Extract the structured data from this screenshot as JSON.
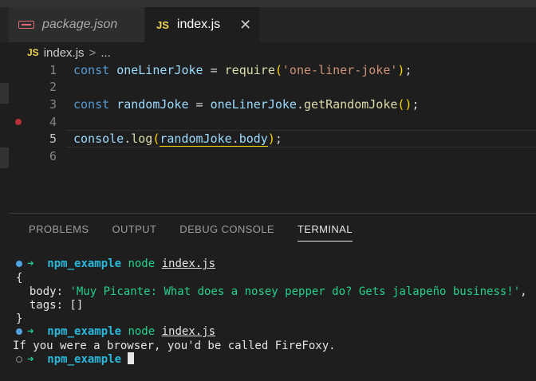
{
  "tabs": [
    {
      "label": "package.json",
      "icon": "json-file-icon"
    },
    {
      "label": "index.js",
      "badge": "JS",
      "close": "✕"
    }
  ],
  "breadcrumb": {
    "badge": "JS",
    "file": "index.js",
    "separator": ">",
    "more": "..."
  },
  "editor": {
    "line_numbers": [
      "1",
      "2",
      "3",
      "4",
      "5",
      "6"
    ],
    "line1": {
      "t1": "const",
      "t2": "oneLinerJoke",
      "t3": " = ",
      "t4": "require",
      "t5": "(",
      "t6": "'one-liner-joke'",
      "t7": ")",
      "t8": ";"
    },
    "line3": {
      "t1": "const",
      "t2": "randomJoke",
      "t3": " = ",
      "t4": "oneLinerJoke",
      "t5": ".",
      "t6": "getRandomJoke",
      "t7": "()",
      "t8": ";"
    },
    "line5": {
      "t1": "console",
      "t2": ".",
      "t3": "log",
      "t4": "(",
      "t5": "randomJoke",
      "t6": ".",
      "t7": "body",
      "t8": ")",
      "t9": ";"
    }
  },
  "panel": {
    "tabs": [
      "PROBLEMS",
      "OUTPUT",
      "DEBUG CONSOLE",
      "TERMINAL"
    ],
    "active_tab": "TERMINAL"
  },
  "terminal": {
    "arrow": "➜",
    "dir": "npm_example",
    "cmd": "node",
    "file": "index.js",
    "brace_open": "{",
    "body_key": "body: ",
    "body_value": "'Muy Picante: What does a nosey pepper do? Gets jalapeño business!'",
    "comma": ",",
    "tags_line": "tags: []",
    "brace_close": "}",
    "output_line": "If you were a browser, you'd be called FireFoxy."
  },
  "colors": {
    "accent": "#569cd6",
    "terminal_green": "#23d18b",
    "terminal_cyan": "#29b8db",
    "js_badge": "#f1d84f"
  }
}
